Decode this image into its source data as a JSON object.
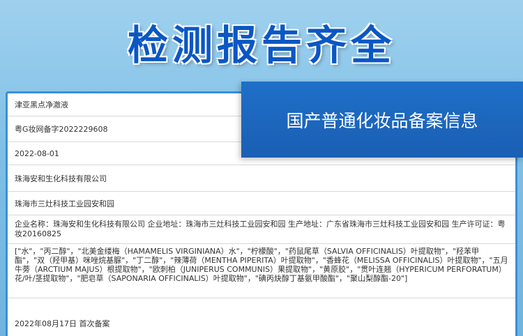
{
  "title": "检测报告齐全",
  "banner": "国产普通化妆品备案信息",
  "rows": {
    "product_name": "津亚黑点净澈液",
    "record_number": "粤G妆网备字2022229608",
    "date": "2022-08-01",
    "company": "珠海安和生化科技有限公司",
    "address": "珠海市三灶科技工业园安和园",
    "manufacturer": "企业名称：珠海安和生化科技有限公司 企业地址：珠海市三灶科技工业园安和园 生产地址：广东省珠海市三灶科技工业园安和园 生产许可证：粤妆20160825",
    "ingredients": "[\"水\"，\"丙二醇\"，\"北美金缕梅（HAMAMELIS VIRGINIANA）水\"，\"柠檬酸\"，\"药鼠尾草（SALVIA OFFICINALIS）叶提取物\"，\"羟苯甲酯\"，\"双（羟甲基）咪唑烷基脲\"，\"丁二醇\"，\"辣薄荷（MENTHA PIPERITA）叶提取物\"，\"香蜂花（MELISSA OFFICINALIS）叶提取物\"，\"五月牛蒡（ARCTIUM MAJUS）根提取物\"，\"欧刺柏（JUNIPERUS COMMUNIS）果提取物\"，\"黄原胶\"，\"贯叶连翘（HYPERICUM PERFORATUM）花/叶/茎提取物\"，\"肥皂草（SAPONARIA OFFICINALIS）叶提取物\"，\"碘丙炔醇丁基氨甲酸酯\"，\"聚山梨醇酯-20\"]",
    "record_status": "2022年08月17日 首次备案"
  }
}
